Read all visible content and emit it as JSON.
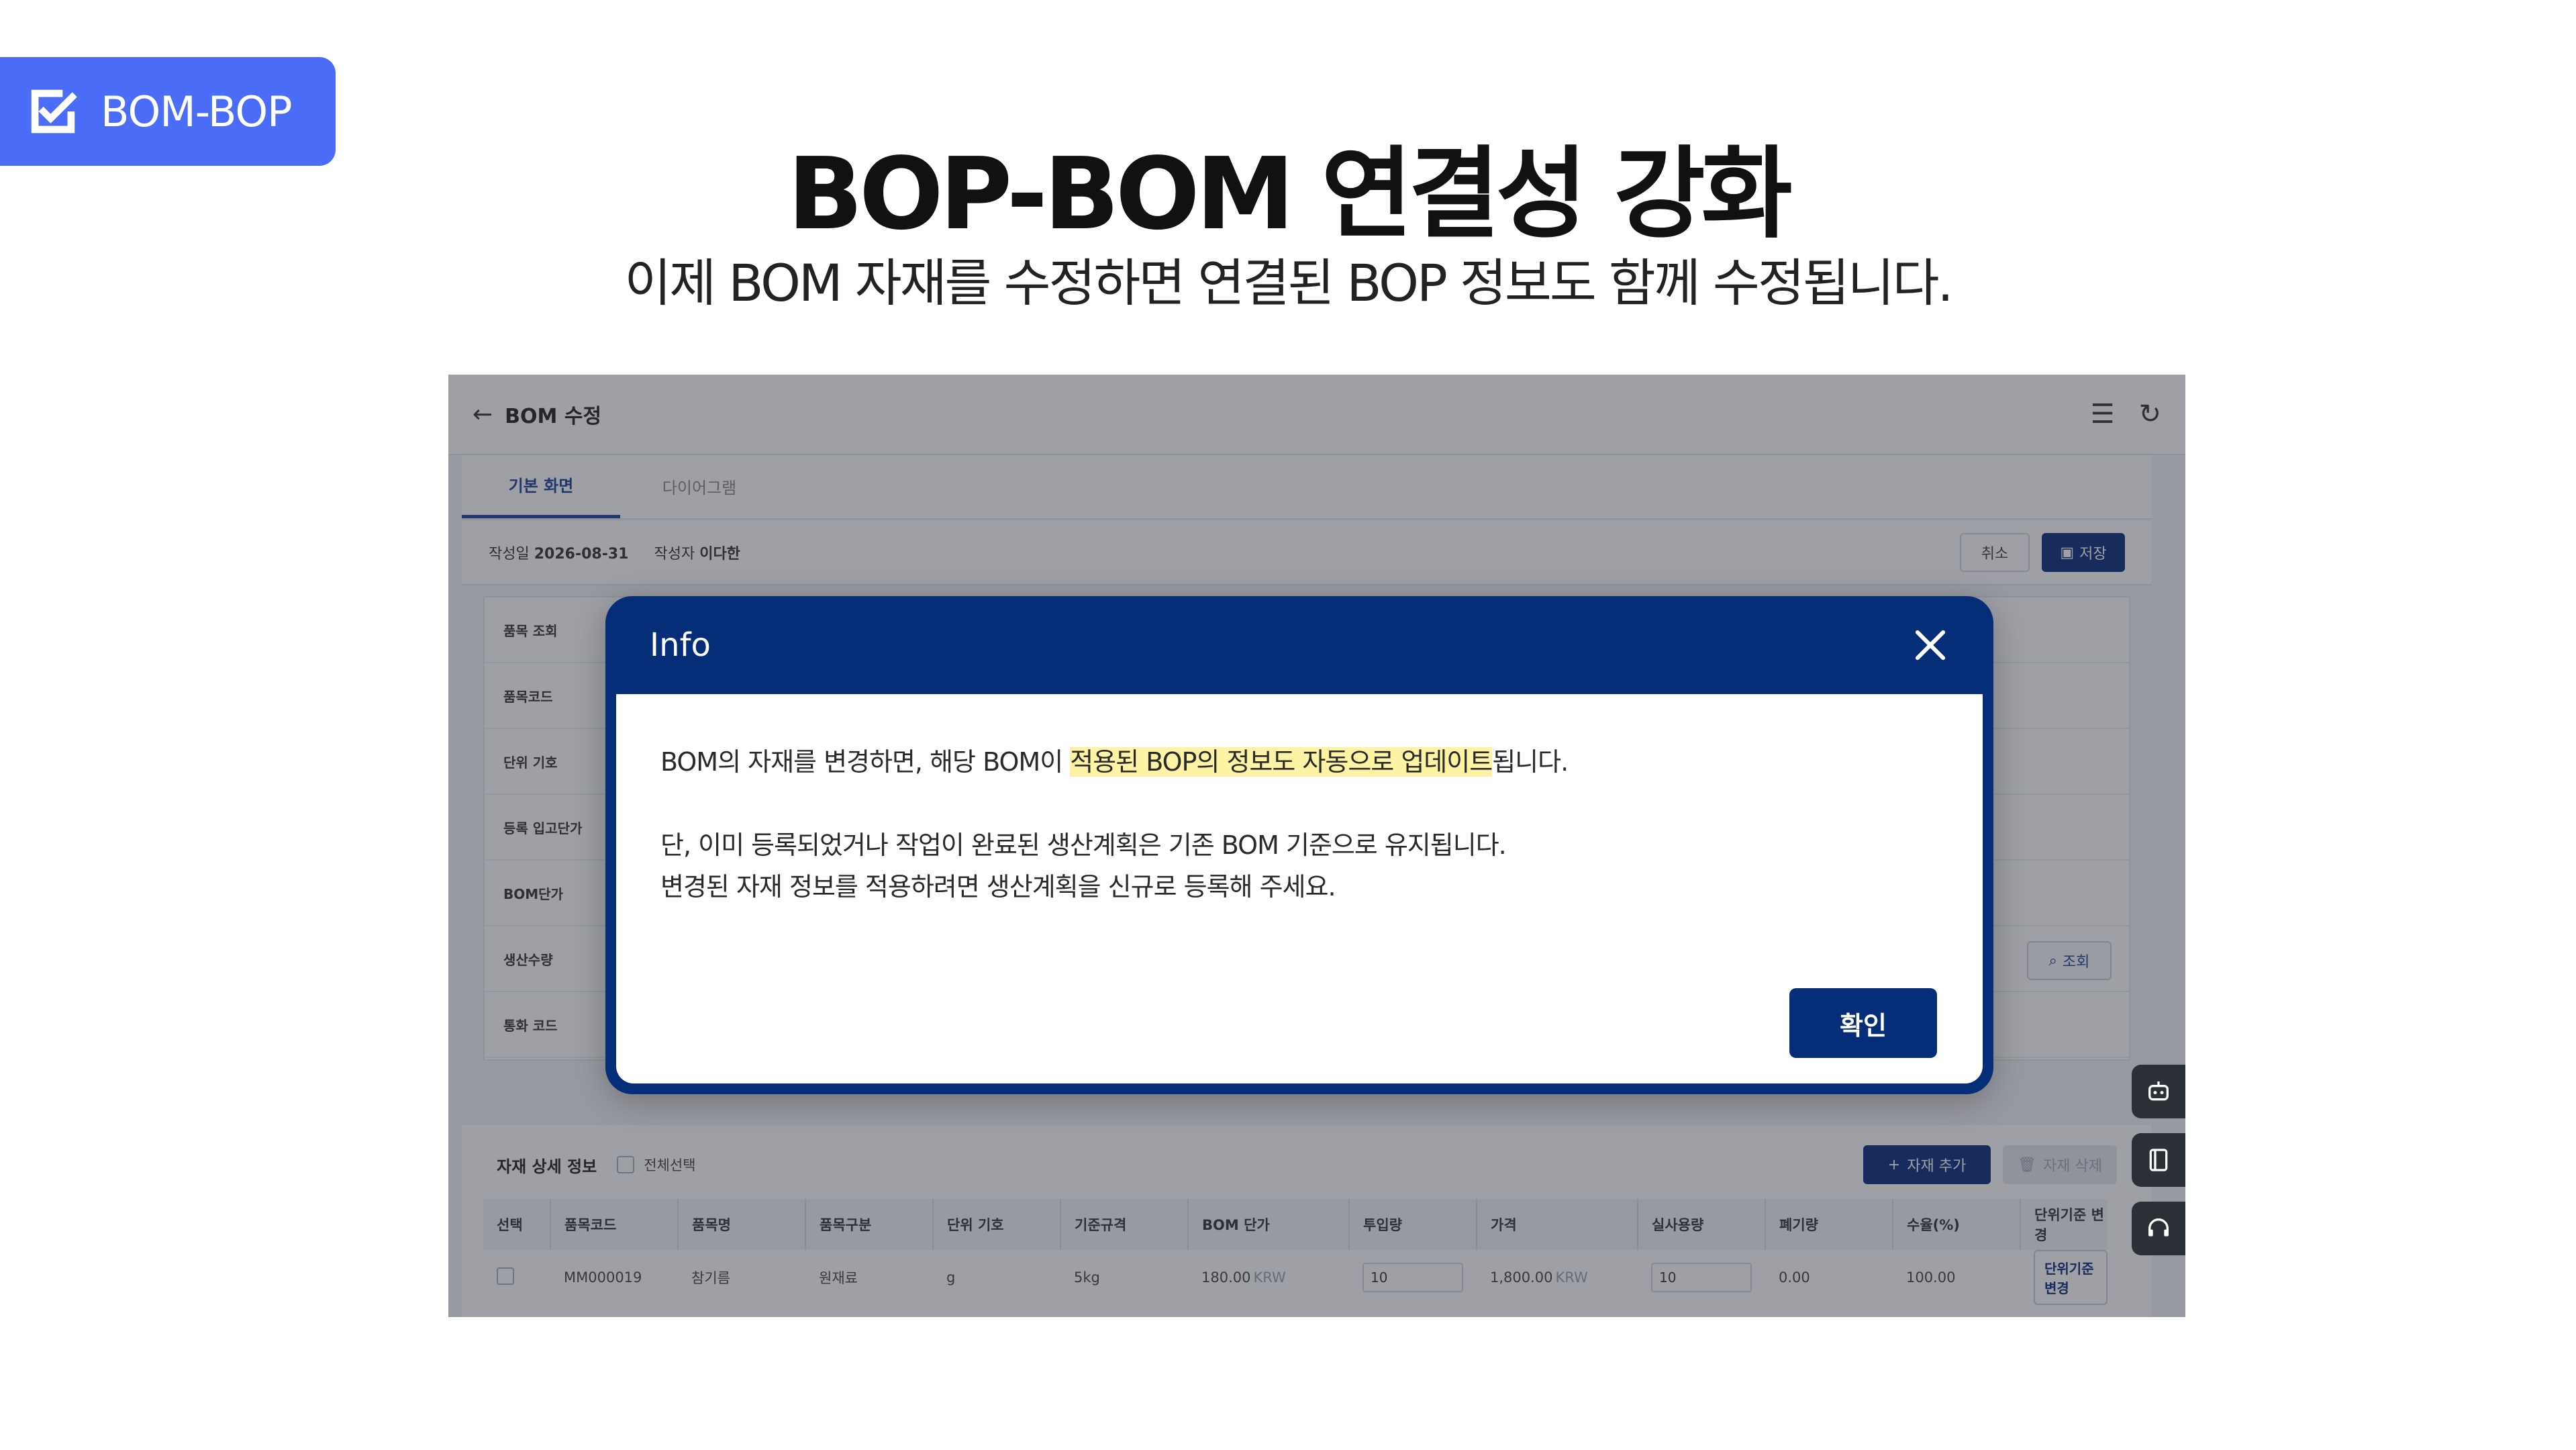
{
  "badge": {
    "label": "BOM-BOP"
  },
  "headline": "BOP-BOM 연결성 강화",
  "subline": "이제 BOM 자재를 수정하면 연결된 BOP 정보도 함께 수정됩니다.",
  "app": {
    "title": "BOM 수정",
    "tabs": [
      {
        "label": "기본 화면"
      },
      {
        "label": "다이어그램"
      }
    ],
    "meta": {
      "date_label": "작성일",
      "date": "2026-08-31",
      "author_label": "작성자",
      "author": "이다한"
    },
    "buttons": {
      "cancel": "취소",
      "save": "저장",
      "search": "조회",
      "add_material": "자재 추가",
      "delete_material": "자재 삭제"
    },
    "form_labels": [
      "품목 조회",
      "품목코드",
      "단위 기호",
      "등록 입고단가",
      "BOM단가",
      "생산수량",
      "통화 코드"
    ],
    "detail": {
      "title": "자재 상세 정보",
      "select_all": "전체선택",
      "columns": [
        "선택",
        "품목코드",
        "품목명",
        "품목구분",
        "단위 기호",
        "기준규격",
        "BOM 단가",
        "투입량",
        "가격",
        "실사용량",
        "폐기량",
        "수율(%)",
        "단위기준 변경"
      ],
      "rows": [
        {
          "code": "MM000019",
          "name": "참기름",
          "category": "원재료",
          "unit": "g",
          "spec": "5kg",
          "bom_price": "180.00",
          "currency": "KRW",
          "input": "10",
          "price": "1,800.00",
          "actual": "10",
          "waste": "0.00",
          "yield": "100.00",
          "unit_change": "단위기준 변경"
        }
      ]
    }
  },
  "modal": {
    "title": "Info",
    "line1_pre": "BOM의 자재를 변경하면, 해당 BOM이 ",
    "line1_hl": "적용된 BOP의 정보도 자동으로 업데이트",
    "line1_post": "됩니다.",
    "line2": "단, 이미 등록되었거나 작업이 완료된 생산계획은 기존 BOM 기준으로 유지됩니다.",
    "line3": "변경된 자재 정보를 적용하려면 생산계획을 신규로 등록해 주세요.",
    "confirm": "확인"
  },
  "colors": {
    "badge": "#4a6cf7",
    "modal_navy": "#062e78",
    "highlight": "#fdf3a4"
  }
}
